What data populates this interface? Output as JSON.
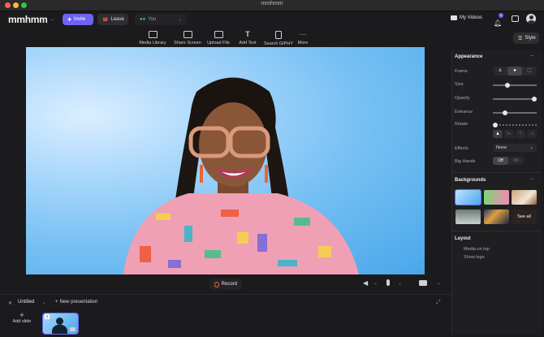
{
  "window": {
    "title": "mmhmm"
  },
  "app": {
    "logo": "mmhmm"
  },
  "header": {
    "invite_label": "Invite",
    "leave_label": "Leave",
    "user_label": "You",
    "my_videos_label": "My Videos",
    "notification_count": "1"
  },
  "toolbar": {
    "items": [
      {
        "label": "Media Library",
        "icon": "media-library-icon"
      },
      {
        "label": "Share Screen",
        "icon": "monitor-icon"
      },
      {
        "label": "Upload File",
        "icon": "upload-file-icon"
      },
      {
        "label": "Add Text",
        "icon": "text-icon"
      },
      {
        "label": "Search GIPHY",
        "icon": "giphy-icon"
      },
      {
        "label": "More",
        "icon": "more-icon"
      }
    ]
  },
  "style_button_label": "Style",
  "panel": {
    "appearance_title": "Appearance",
    "frame_label": "Frame",
    "size_label": "Size",
    "opacity_label": "Opacity",
    "entrance_label": "Entrance",
    "rotate_label": "Rotate",
    "effects_label": "Effects",
    "effects_value": "None",
    "big_hands_label": "Big Hands",
    "big_hands_off": "Off",
    "big_hands_on": "On",
    "sliders": {
      "size": 0.32,
      "opacity": 1.0,
      "entrance": 0.25,
      "rotate": 0.0
    },
    "backgrounds_title": "Backgrounds",
    "see_all_label": "See all",
    "layout_title": "Layout",
    "layout_options": [
      "Media on top",
      "Show logo"
    ]
  },
  "record": {
    "label": "Record"
  },
  "slides_bar": {
    "presentation_name": "Untitled",
    "new_presentation_label": "New presentation",
    "add_slide_label": "Add slide",
    "slide_number": "1"
  },
  "colors": {
    "invite": "#6c63f0",
    "leave": "#2e2e31",
    "record": "#e8643a",
    "accent": "#6c63f0"
  }
}
